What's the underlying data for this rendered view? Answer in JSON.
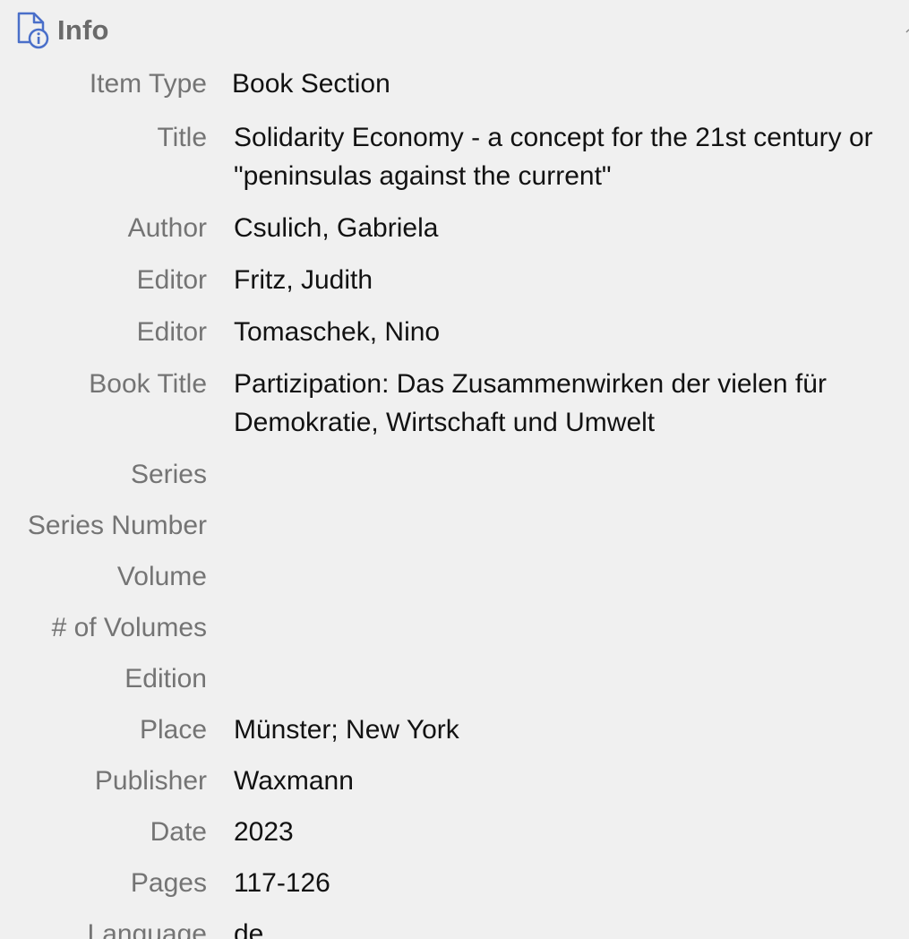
{
  "section": {
    "title": "Info",
    "icon": "document-info-icon",
    "accent_color": "#4a6fc9"
  },
  "fields": [
    {
      "label": "Item Type",
      "value": "Book Section"
    },
    {
      "label": "Title",
      "value": "Solidarity Economy - a concept for the 21st century or \"peninsulas against the current\""
    },
    {
      "label": "Author",
      "value": "Csulich, Gabriela"
    },
    {
      "label": "Editor",
      "value": "Fritz, Judith"
    },
    {
      "label": "Editor",
      "value": "Tomaschek, Nino"
    },
    {
      "label": "Book Title",
      "value": "Partizipation: Das Zusammenwirken der vielen für Demokratie, Wirtschaft und Umwelt"
    },
    {
      "label": "Series",
      "value": ""
    },
    {
      "label": "Series Number",
      "value": ""
    },
    {
      "label": "Volume",
      "value": ""
    },
    {
      "label": "# of Volumes",
      "value": ""
    },
    {
      "label": "Edition",
      "value": ""
    },
    {
      "label": "Place",
      "value": "Münster; New York"
    },
    {
      "label": "Publisher",
      "value": "Waxmann"
    },
    {
      "label": "Date",
      "value": "2023"
    },
    {
      "label": "Pages",
      "value": "117-126"
    },
    {
      "label": "Language",
      "value": "de"
    }
  ]
}
